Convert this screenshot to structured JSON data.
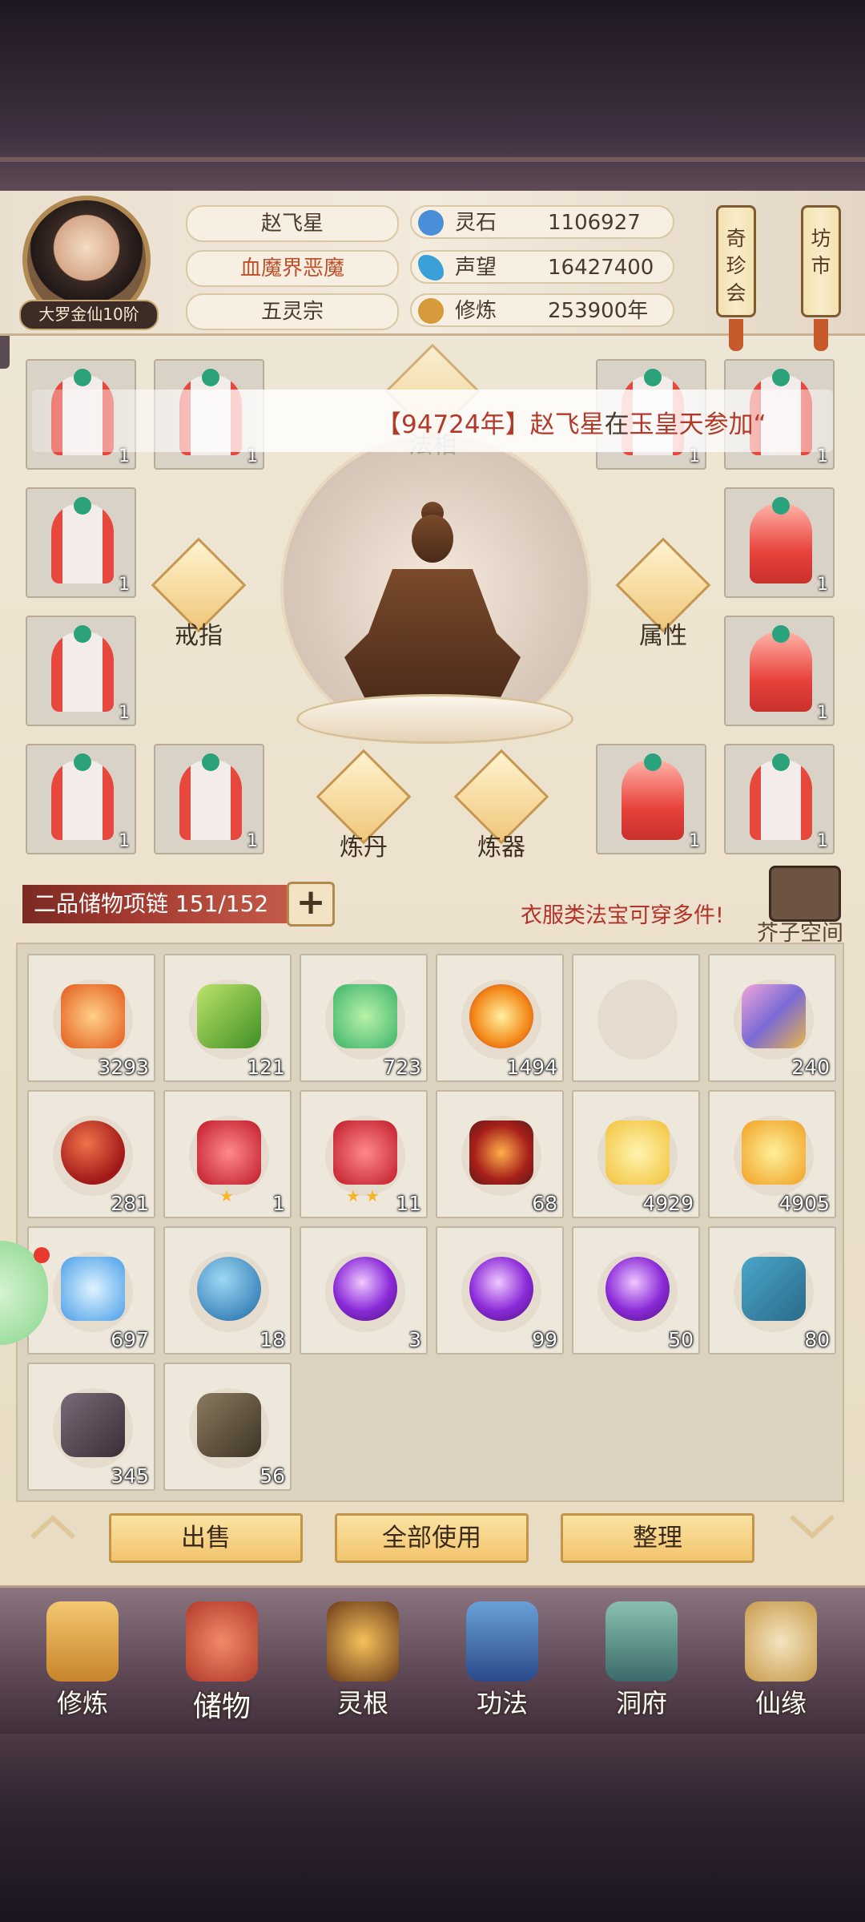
{
  "player": {
    "name": "赵飞星",
    "title": "血魔界恶魔",
    "sect": "五灵宗",
    "rank": "大罗金仙10阶"
  },
  "stats": [
    {
      "label": "灵石",
      "value": "1106927",
      "icon": "spirit-stone-icon",
      "color": "#4a8ed8"
    },
    {
      "label": "声望",
      "value": "16427400",
      "icon": "reputation-crystal-icon",
      "color": "#3aa0d8"
    },
    {
      "label": "修炼",
      "value": "253900年",
      "icon": "meditation-icon",
      "color": "#d69a3a"
    }
  ],
  "side_buttons": [
    "奇珍会",
    "坊市"
  ],
  "marquee": {
    "text1": "【94724年】赵飞星",
    "text2": "在",
    "text3": "玉皇天参加“",
    "highlight_color": "#b33a2a"
  },
  "center": {
    "faxiang_label": "法相",
    "ring_label": "戒指",
    "attr_label": "属性",
    "alchemy_label": "炼丹",
    "forge_label": "炼器"
  },
  "equip_counts": {
    "r1c1": "1",
    "r1c2": "1",
    "r1c5": "1",
    "r1c6": "1",
    "r2c1": "1",
    "r2c6": "1",
    "r3c1": "1",
    "r3c6": "1",
    "r4c1": "1",
    "r4c2": "1",
    "r4c5": "1",
    "r4c6": "1"
  },
  "container": {
    "label": "二品储物项链 151/152",
    "plus": "+",
    "hint": "衣服类法宝可穿多件!",
    "space_label": "芥子空间"
  },
  "inventory": [
    {
      "icon": "fire-crystal-icon",
      "count": "3293"
    },
    {
      "icon": "green-bamboo-icon",
      "count": "121"
    },
    {
      "icon": "jade-swirl-icon",
      "count": "723"
    },
    {
      "icon": "fireball-icon",
      "count": "1494"
    },
    {
      "icon": "empty-slot",
      "count": ""
    },
    {
      "icon": "scroll-icon",
      "count": "240"
    },
    {
      "icon": "red-orb-icon",
      "count": "281"
    },
    {
      "icon": "red-flame-1star-icon",
      "count": "1"
    },
    {
      "icon": "red-flame-2star-icon",
      "count": "11"
    },
    {
      "icon": "fire-vortex-icon",
      "count": "68"
    },
    {
      "icon": "golden-flower-icon",
      "count": "4929"
    },
    {
      "icon": "golden-blaze-icon",
      "count": "4905"
    },
    {
      "icon": "water-spirit-icon",
      "count": "697"
    },
    {
      "icon": "blue-orb-pedestal-icon",
      "count": "18"
    },
    {
      "icon": "purple-orb-icon",
      "count": "3"
    },
    {
      "icon": "purple-orb-icon",
      "count": "99"
    },
    {
      "icon": "purple-orb-icon",
      "count": "50"
    },
    {
      "icon": "blue-scroll-icon",
      "count": "80"
    },
    {
      "icon": "dark-ore-icon",
      "count": "345"
    },
    {
      "icon": "golden-ore-icon",
      "count": "56"
    }
  ],
  "actions": {
    "sell": "出售",
    "use_all": "全部使用",
    "organize": "整理"
  },
  "nav": [
    {
      "label": "修炼",
      "icon": "cultivate-icon"
    },
    {
      "label": "储物",
      "icon": "storage-bag-icon"
    },
    {
      "label": "灵根",
      "icon": "spirit-root-icon"
    },
    {
      "label": "功法",
      "icon": "technique-book-icon"
    },
    {
      "label": "洞府",
      "icon": "cave-mansion-icon"
    },
    {
      "label": "仙缘",
      "icon": "immortal-fate-icon"
    }
  ]
}
